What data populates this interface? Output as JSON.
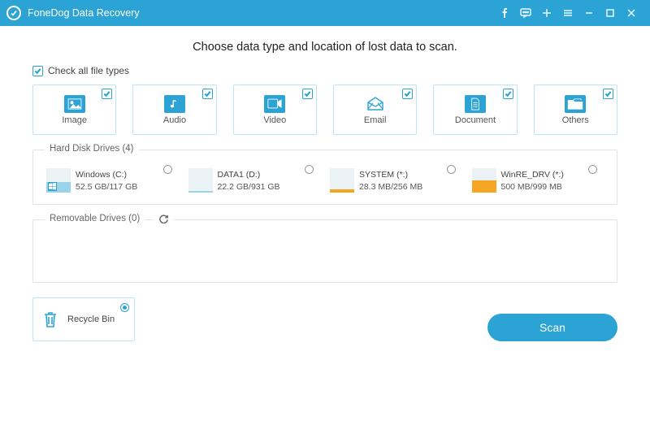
{
  "app": {
    "title": "FoneDog Data Recovery"
  },
  "heading": "Choose data type and location of lost data to scan.",
  "check_all_label": "Check all file types",
  "type_cards": [
    {
      "label": "Image"
    },
    {
      "label": "Audio"
    },
    {
      "label": "Video"
    },
    {
      "label": "Email"
    },
    {
      "label": "Document"
    },
    {
      "label": "Others"
    }
  ],
  "hdd_group_title": "Hard Disk Drives (4)",
  "removable_group_title": "Removable Drives (0)",
  "drives": [
    {
      "name": "Windows (C:)",
      "size": "52.5 GB/117 GB"
    },
    {
      "name": "DATA1 (D:)",
      "size": "22.2 GB/931 GB"
    },
    {
      "name": "SYSTEM (*:)",
      "size": "28.3 MB/256 MB"
    },
    {
      "name": "WinRE_DRV (*:)",
      "size": "500 MB/999 MB"
    }
  ],
  "recycle_label": "Recycle Bin",
  "scan_label": "Scan"
}
